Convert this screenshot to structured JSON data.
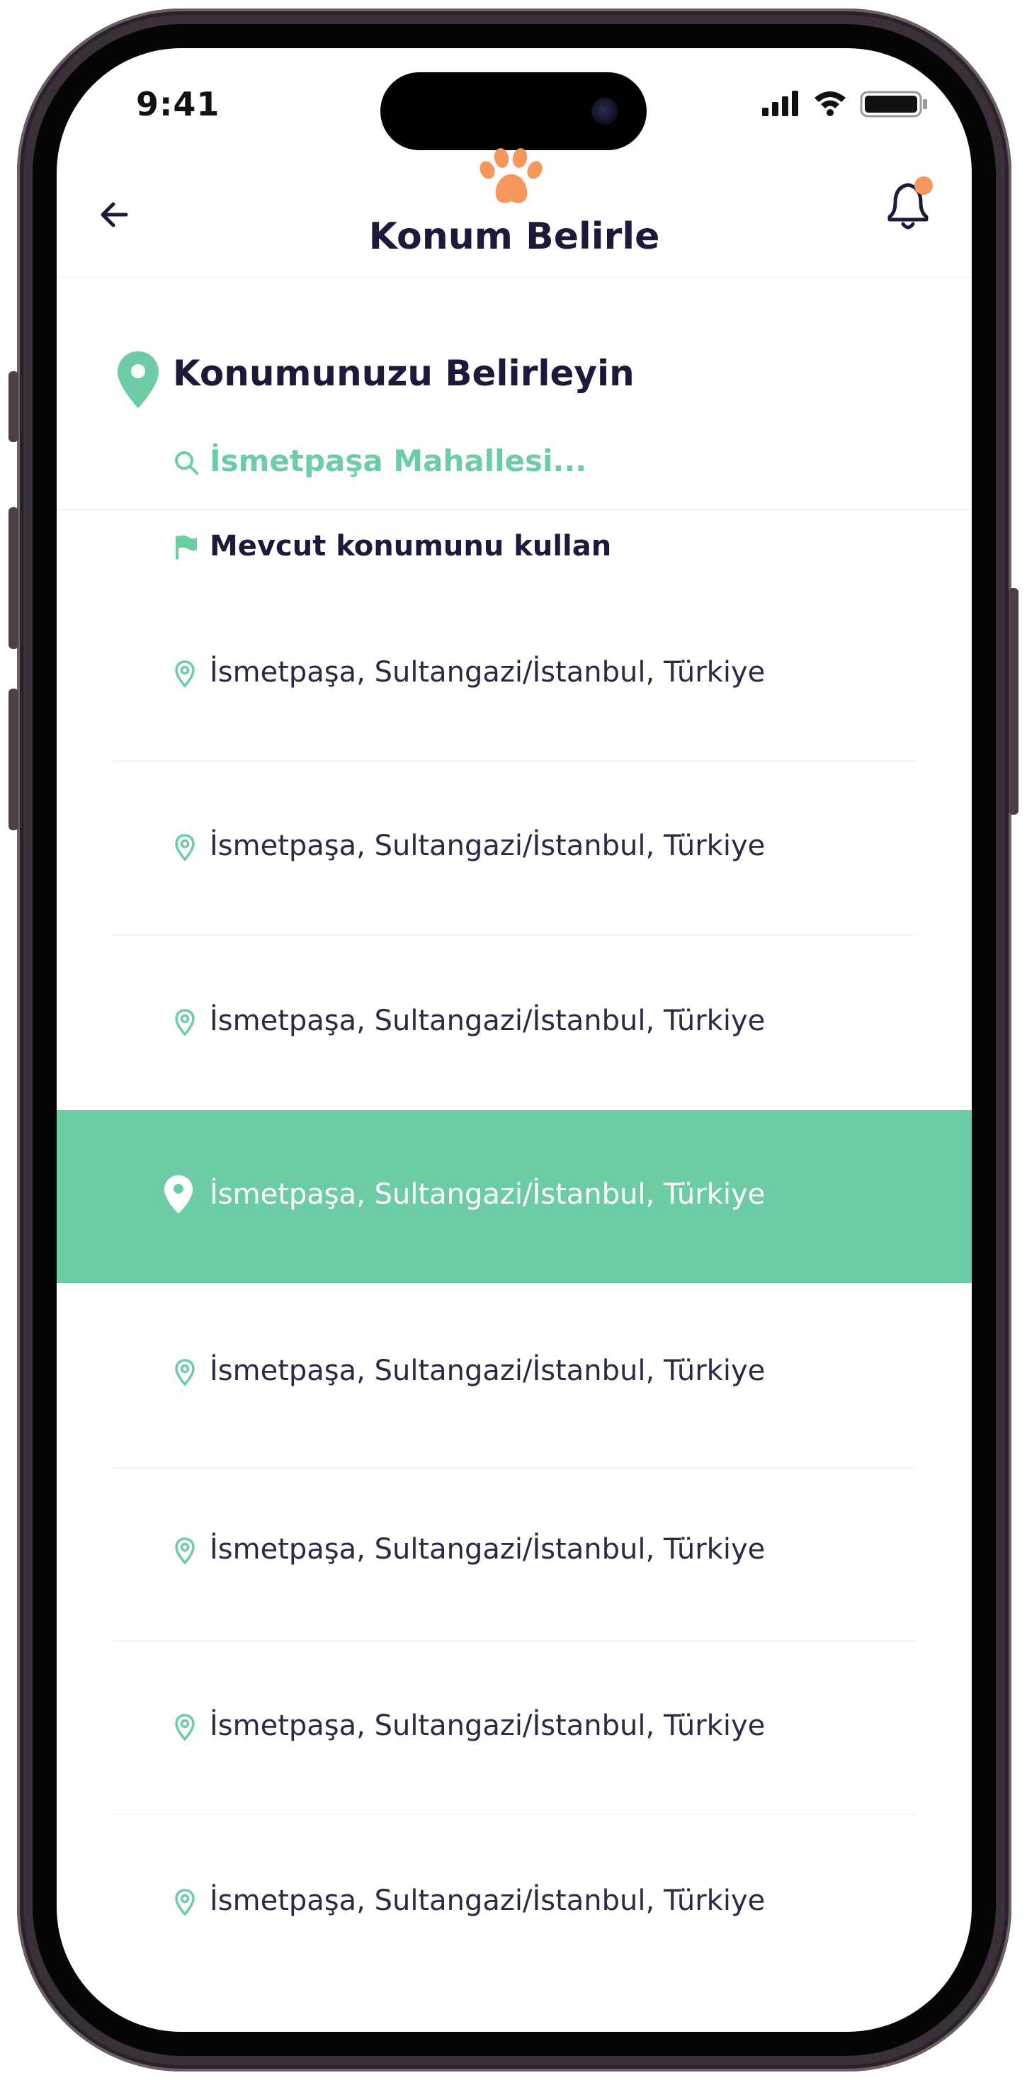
{
  "status_bar": {
    "time": "9:41"
  },
  "nav": {
    "title": "Konum Belirle",
    "back_icon": "arrow-left-icon",
    "notification_icon": "bell-icon",
    "logo_icon": "paw-icon"
  },
  "section": {
    "title": "Konumunuzu Belirleyin",
    "icon": "location-pin-icon"
  },
  "search": {
    "value": "İsmetpaşa Mahallesi..."
  },
  "current_location": {
    "label": "Mevcut konumunu kullan",
    "icon": "flag-icon"
  },
  "results": [
    {
      "address": "İsmetpaşa, Sultangazi/İstanbul, Türkiye",
      "selected": false
    },
    {
      "address": "İsmetpaşa, Sultangazi/İstanbul, Türkiye",
      "selected": false
    },
    {
      "address": "İsmetpaşa, Sultangazi/İstanbul, Türkiye",
      "selected": false
    },
    {
      "address": "İsmetpaşa, Sultangazi/İstanbul, Türkiye",
      "selected": true
    },
    {
      "address": "İsmetpaşa, Sultangazi/İstanbul, Türkiye",
      "selected": false
    },
    {
      "address": "İsmetpaşa, Sultangazi/İstanbul, Türkiye",
      "selected": false
    },
    {
      "address": "İsmetpaşa, Sultangazi/İstanbul, Türkiye",
      "selected": false
    },
    {
      "address": "İsmetpaşa, Sultangazi/İstanbul, Türkiye",
      "selected": false
    }
  ],
  "colors": {
    "accent": "#6ccca3",
    "brand_orange": "#f5965a",
    "text_dark": "#1b1a3a",
    "frame": "#3a3038"
  }
}
